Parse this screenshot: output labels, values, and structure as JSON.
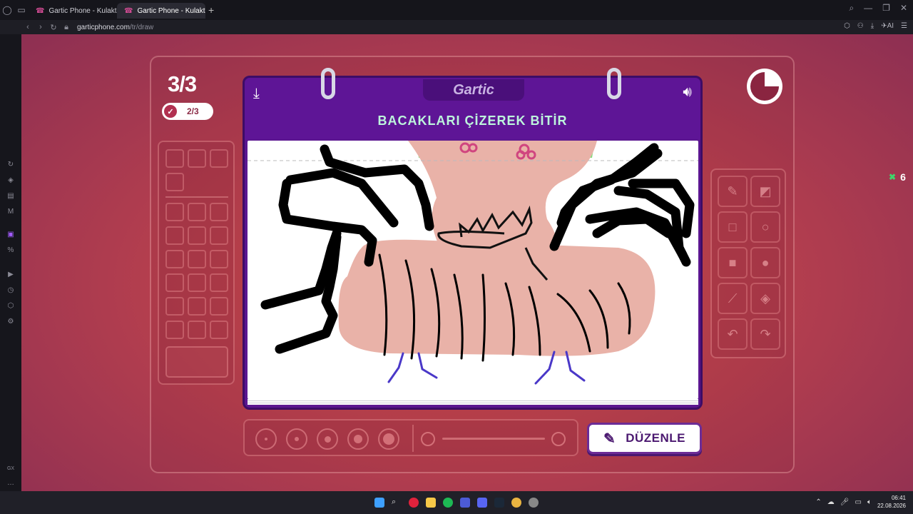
{
  "browser": {
    "tabs": [
      {
        "title": "Gartic Phone - Kulaktan Ku",
        "active": false
      },
      {
        "title": "Gartic Phone - Kulaktan Ku",
        "active": true
      }
    ],
    "url_host": "garticphone.com",
    "url_path": "/tr/draw",
    "ai_label": "AI"
  },
  "sidebar": {
    "bottom_label": "GX"
  },
  "game": {
    "round": "3/3",
    "progress": "2/3",
    "logo": "Gartic",
    "prompt": "BACAKLARI ÇİZEREK BİTİR",
    "score": "6",
    "timer_fraction_remaining": 0.75,
    "edit_button": "DÜZENLE",
    "brush_sizes": 5,
    "tools": [
      "pencil-icon",
      "eraser-icon",
      "rect-outline-icon",
      "circle-outline-icon",
      "rect-fill-icon",
      "circle-fill-icon",
      "line-icon",
      "fill-icon",
      "undo-icon",
      "redo-icon"
    ]
  },
  "taskbar": {
    "time": "06:41",
    "date": "22.08.2026"
  },
  "colors": {
    "accent_purple": "#5e1596",
    "prompt_text": "#bdf5dc",
    "skin": "#e9b2a8"
  }
}
